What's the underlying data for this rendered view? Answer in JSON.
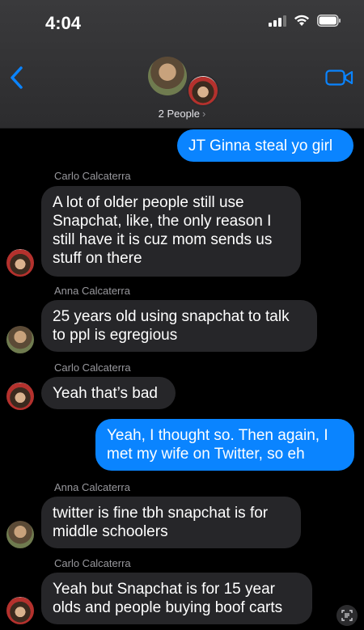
{
  "status_bar": {
    "time": "4:04"
  },
  "header": {
    "people_label": "2 People",
    "chevron": "›"
  },
  "messages": [
    {
      "type": "sent",
      "text": "JT Ginna steal yo girl"
    },
    {
      "type": "recv",
      "sender": "Carlo Calcaterra",
      "text": "A lot of older people still use Snapchat, like, the only reason I still have it is cuz mom sends us stuff on there"
    },
    {
      "type": "recv",
      "sender": "Anna Calcaterra",
      "text": "25 years old using snapchat to talk to ppl is egregious"
    },
    {
      "type": "recv",
      "sender": "Carlo Calcaterra",
      "text": "Yeah that’s bad"
    },
    {
      "type": "sent",
      "text": "Yeah, I thought so. Then again, I met my wife on Twitter, so eh"
    },
    {
      "type": "recv",
      "sender": "Anna Calcaterra",
      "text": "twitter is fine tbh snapchat is for middle schoolers"
    },
    {
      "type": "recv",
      "sender": "Carlo Calcaterra",
      "text": "Yeah but Snapchat is for 15 year olds and people buying boof carts"
    }
  ],
  "colors": {
    "sent_bubble": "#0a84ff",
    "received_bubble": "#262629",
    "accent": "#0a84ff"
  }
}
